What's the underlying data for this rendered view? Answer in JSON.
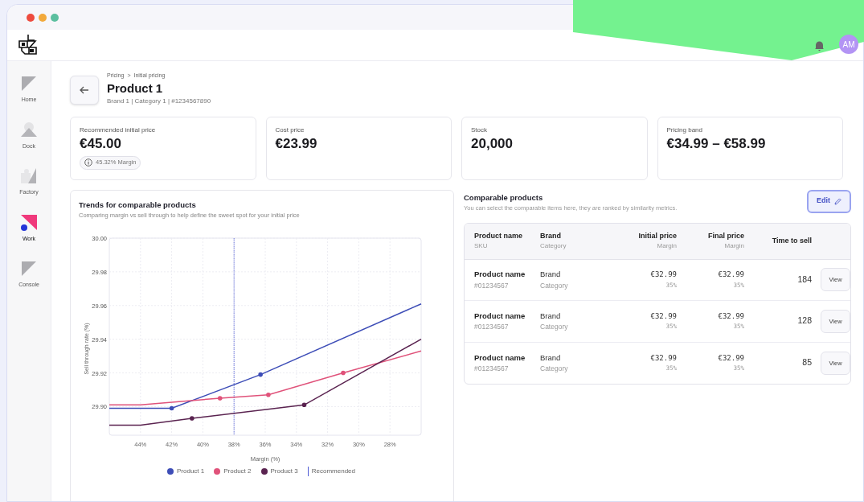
{
  "window": {
    "controls": [
      {
        "color": "#ee4b3e"
      },
      {
        "color": "#f2a93b"
      },
      {
        "color": "#5bbf9f"
      }
    ]
  },
  "header": {
    "avatar": "AM"
  },
  "sidebar": {
    "items": [
      {
        "label": "Home",
        "kind": "home",
        "selected": false
      },
      {
        "label": "Dock",
        "kind": "dock",
        "selected": false
      },
      {
        "label": "Factory",
        "kind": "factory",
        "selected": false
      },
      {
        "label": "Work",
        "kind": "work",
        "selected": true
      },
      {
        "label": "Console",
        "kind": "console",
        "selected": false
      }
    ]
  },
  "breadcrumb": {
    "items": [
      "Pricing",
      "Initial pricing"
    ],
    "separator": ">"
  },
  "product": {
    "title": "Product 1",
    "subtitle": "Brand 1 | Category 1 | #1234567890"
  },
  "stats": [
    {
      "label": "Recommended initial price",
      "value": "€45.00",
      "badge": "45.32% Margin"
    },
    {
      "label": "Cost price",
      "value": "€23.99"
    },
    {
      "label": "Stock",
      "value": "20,000"
    },
    {
      "label": "Pricing band",
      "value": "€34.99 – €58.99"
    }
  ],
  "trends": {
    "title": "Trends for comparable products",
    "subtitle": "Comparing margin vs sell through to help define the sweet spot for your initial price",
    "chart_data": {
      "type": "line",
      "xlabel": "Margin (%)",
      "ylabel": "Sell through rate (%)",
      "xlim": [
        46,
        26
      ],
      "ylim": [
        29.883,
        30.0
      ],
      "xticks": [
        {
          "value": 44,
          "label": "44%"
        },
        {
          "value": 42,
          "label": "42%"
        },
        {
          "value": 40,
          "label": "40%"
        },
        {
          "value": 38,
          "label": "38%"
        },
        {
          "value": 36,
          "label": "36%"
        },
        {
          "value": 34,
          "label": "34%"
        },
        {
          "value": 32,
          "label": "32%"
        },
        {
          "value": 30,
          "label": "30%"
        },
        {
          "value": 28,
          "label": "28%"
        }
      ],
      "yticks": [
        {
          "value": 29.9,
          "label": "29.90"
        },
        {
          "value": 29.92,
          "label": "29.92"
        },
        {
          "value": 29.94,
          "label": "29.94"
        },
        {
          "value": 29.96,
          "label": "29.96"
        },
        {
          "value": 29.98,
          "label": "29.98"
        },
        {
          "value": 30.0,
          "label": "30.00"
        }
      ],
      "series": [
        {
          "name": "Product 1",
          "color": "#3d4db7",
          "x": [
            46,
            42,
            36.3,
            26
          ],
          "values": [
            29.899,
            29.899,
            29.919,
            29.961
          ]
        },
        {
          "name": "Product 2",
          "color": "#e0527a",
          "x": [
            46,
            44,
            38.9,
            35.8,
            31,
            26
          ],
          "values": [
            29.901,
            29.901,
            29.905,
            29.907,
            29.92,
            29.933
          ]
        },
        {
          "name": "Product 3",
          "color": "#5a2350",
          "x": [
            46,
            44,
            40.7,
            33.5,
            26
          ],
          "values": [
            29.889,
            29.889,
            29.893,
            29.901,
            29.94
          ]
        }
      ],
      "grid": true,
      "ref_lines": [
        {
          "axis": "x",
          "value": 38,
          "label": "Recommended"
        }
      ]
    }
  },
  "comparable": {
    "title": "Comparable products",
    "subtitle": "You can select the comparable items here, they are ranked by similarity metrics.",
    "edit_button": "Edit",
    "columns": [
      {
        "title": "Product name",
        "subtitle": "SKU"
      },
      {
        "title": "Brand",
        "subtitle": "Category"
      },
      {
        "title": "Initial price",
        "subtitle": "Margin"
      },
      {
        "title": "Final price",
        "subtitle": "Margin"
      },
      {
        "title": "Time to sell"
      }
    ],
    "rows": [
      {
        "cells": [
          [
            "Product name",
            "#01234567"
          ],
          [
            "Brand",
            "Category"
          ],
          [
            "€32.99",
            "35%"
          ],
          [
            "€32.99",
            "35%"
          ],
          [
            "184"
          ]
        ],
        "action": "View"
      },
      {
        "cells": [
          [
            "Product name",
            "#01234567"
          ],
          [
            "Brand",
            "Category"
          ],
          [
            "€32.99",
            "35%"
          ],
          [
            "€32.99",
            "35%"
          ],
          [
            "128"
          ]
        ],
        "action": "View"
      },
      {
        "cells": [
          [
            "Product name",
            "#01234567"
          ],
          [
            "Brand",
            "Category"
          ],
          [
            "€32.99",
            "35%"
          ],
          [
            "€32.99",
            "35%"
          ],
          [
            "85"
          ]
        ],
        "action": "View"
      }
    ]
  }
}
